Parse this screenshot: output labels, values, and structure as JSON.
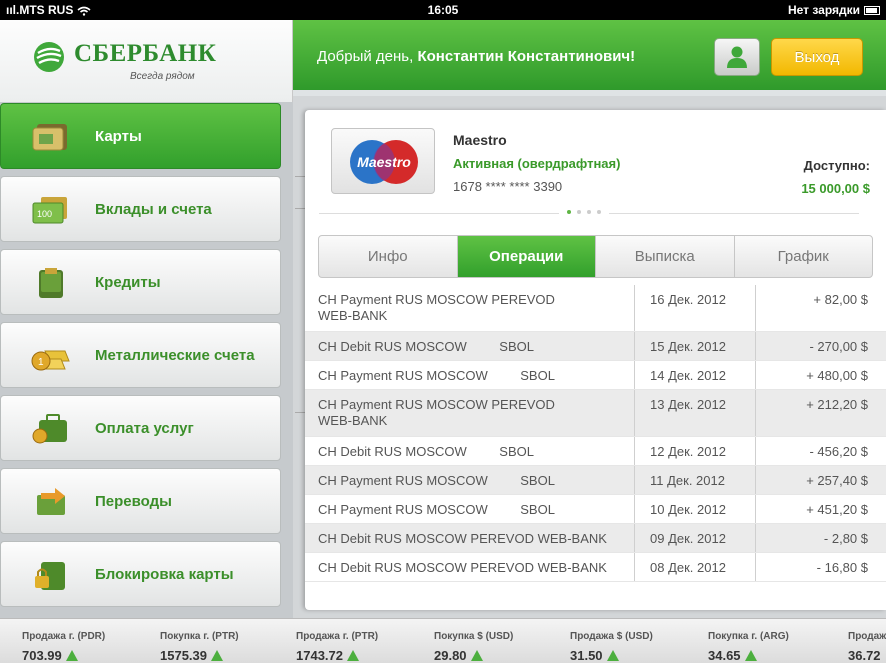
{
  "status": {
    "carrier": "MTS RUS",
    "time": "16:05",
    "battery_text": "Нет зарядки"
  },
  "brand": {
    "name": "СБЕРБАНК",
    "tagline": "Всегда рядом"
  },
  "header": {
    "greeting_prefix": "Добрый день, ",
    "user_name": "Константин Константинович!",
    "exit_label": "Выход"
  },
  "nav": [
    {
      "label": "Карты",
      "icon": "card-icon"
    },
    {
      "label": "Вклады и счета",
      "icon": "banknotes-icon"
    },
    {
      "label": "Кредиты",
      "icon": "wallet-icon"
    },
    {
      "label": "Металлические счета",
      "icon": "gold-bars-icon"
    },
    {
      "label": "Оплата услуг",
      "icon": "briefcase-icon"
    },
    {
      "label": "Переводы",
      "icon": "transfer-icon"
    },
    {
      "label": "Блокировка карты",
      "icon": "lock-icon"
    }
  ],
  "card": {
    "brand": "Maestro",
    "status": "Активная (овердрафтная)",
    "number": "1678 **** **** 3390",
    "available_label": "Доступно:",
    "available_value": "15 000,00 $",
    "page_count": 4,
    "page_active": 1
  },
  "tabs": [
    "Инфо",
    "Операции",
    "Выписка",
    "График"
  ],
  "active_tab": 1,
  "operations": [
    {
      "desc": "CH Payment RUS MOSCOW PEREVOD WEB-BANK",
      "date": "16 Дек. 2012",
      "amount": "+ 82,00 $"
    },
    {
      "desc": "CH Debit RUS MOSCOW         SBOL",
      "date": "15 Дек. 2012",
      "amount": "- 270,00 $"
    },
    {
      "desc": "CH Payment RUS MOSCOW         SBOL",
      "date": "14 Дек. 2012",
      "amount": "+ 480,00 $"
    },
    {
      "desc": "CH Payment RUS MOSCOW PEREVOD WEB-BANK",
      "date": "13 Дек. 2012",
      "amount": "+ 212,20 $"
    },
    {
      "desc": "CH Debit RUS MOSCOW         SBOL",
      "date": "12 Дек. 2012",
      "amount": "- 456,20 $"
    },
    {
      "desc": "CH Payment RUS MOSCOW         SBOL",
      "date": "11 Дек. 2012",
      "amount": "+ 257,40 $"
    },
    {
      "desc": "CH Payment RUS MOSCOW         SBOL",
      "date": "10 Дек. 2012",
      "amount": "+ 451,20 $"
    },
    {
      "desc": "CH Debit RUS MOSCOW PEREVOD WEB-BANK",
      "date": "09 Дек. 2012",
      "amount": "- 2,80 $"
    },
    {
      "desc": "CH Debit RUS MOSCOW PEREVOD WEB-BANK",
      "date": "08 Дек. 2012",
      "amount": "- 16,80 $"
    }
  ],
  "ticker": [
    {
      "label": "Продажа г. (PDR)",
      "value": "703.99"
    },
    {
      "label": "Покупка г. (PTR)",
      "value": "1575.39"
    },
    {
      "label": "Продажа г. (PTR)",
      "value": "1743.72"
    },
    {
      "label": "Покупка $ (USD)",
      "value": "29.80"
    },
    {
      "label": "Продажа $ (USD)",
      "value": "31.50"
    },
    {
      "label": "Покупка г. (ARG)",
      "value": "34.65"
    },
    {
      "label": "Продаж",
      "value": "36.72"
    }
  ],
  "colors": {
    "brand_green": "#3a9a2a",
    "active_green": "#4cb33a",
    "exit_yellow": "#f5c518"
  }
}
